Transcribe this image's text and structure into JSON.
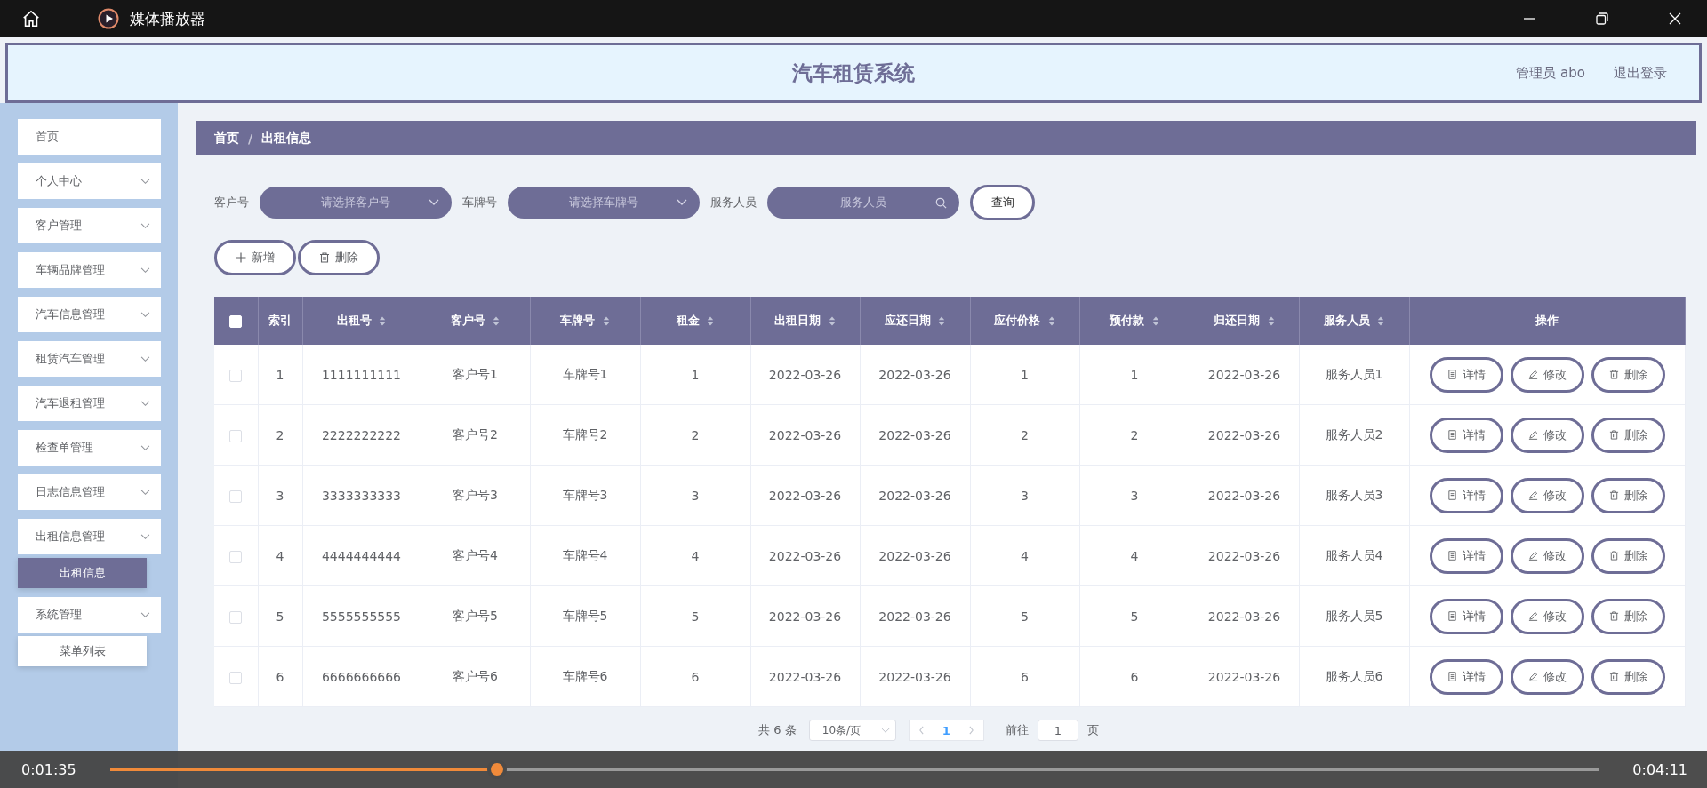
{
  "window": {
    "title": "媒体播放器"
  },
  "header": {
    "title": "汽车租赁系统",
    "user": "管理员 abo",
    "logout": "退出登录"
  },
  "sidebar": {
    "items": [
      {
        "kind": "link",
        "label": "首页"
      },
      {
        "kind": "menu",
        "label": "个人中心"
      },
      {
        "kind": "menu",
        "label": "客户管理"
      },
      {
        "kind": "menu",
        "label": "车辆品牌管理"
      },
      {
        "kind": "menu",
        "label": "汽车信息管理"
      },
      {
        "kind": "menu",
        "label": "租赁汽车管理"
      },
      {
        "kind": "menu",
        "label": "汽车退租管理"
      },
      {
        "kind": "menu",
        "label": "检查单管理"
      },
      {
        "kind": "menu",
        "label": "日志信息管理"
      },
      {
        "kind": "menu",
        "label": "出租信息管理",
        "children": [
          {
            "label": "出租信息",
            "selected": true
          }
        ]
      },
      {
        "kind": "menu",
        "label": "系统管理",
        "children": [
          {
            "label": "菜单列表",
            "selected": false
          }
        ]
      }
    ]
  },
  "breadcrumb": {
    "items": [
      "首页",
      "出租信息"
    ],
    "separator": "/"
  },
  "filters": [
    {
      "kind": "select",
      "label": "客户号",
      "placeholder": "请选择客户号"
    },
    {
      "kind": "select",
      "label": "车牌号",
      "placeholder": "请选择车牌号"
    },
    {
      "kind": "search",
      "label": "服务人员",
      "placeholder": "服务人员"
    }
  ],
  "query_button": "查询",
  "toolbar": [
    {
      "kind": "add",
      "label": "新增"
    },
    {
      "kind": "delete",
      "label": "删除"
    }
  ],
  "table": {
    "select_all": {
      "checked": false
    },
    "columns": [
      {
        "label": "索引",
        "sortable": false
      },
      {
        "label": "出租号",
        "sortable": true
      },
      {
        "label": "客户号",
        "sortable": true
      },
      {
        "label": "车牌号",
        "sortable": true
      },
      {
        "label": "租金",
        "sortable": true
      },
      {
        "label": "出租日期",
        "sortable": true
      },
      {
        "label": "应还日期",
        "sortable": true
      },
      {
        "label": "应付价格",
        "sortable": true
      },
      {
        "label": "预付款",
        "sortable": true
      },
      {
        "label": "归还日期",
        "sortable": true
      },
      {
        "label": "服务人员",
        "sortable": true
      },
      {
        "label": "操作",
        "sortable": false
      }
    ],
    "rows": [
      {
        "checked": false,
        "cells": [
          "1",
          "1111111111",
          "客户号1",
          "车牌号1",
          "1",
          "2022-03-26",
          "2022-03-26",
          "1",
          "1",
          "2022-03-26",
          "服务人员1"
        ],
        "actions": [
          {
            "kind": "detail",
            "label": "详情"
          },
          {
            "kind": "edit",
            "label": "修改"
          },
          {
            "kind": "delete",
            "label": "删除"
          }
        ]
      },
      {
        "checked": false,
        "cells": [
          "2",
          "2222222222",
          "客户号2",
          "车牌号2",
          "2",
          "2022-03-26",
          "2022-03-26",
          "2",
          "2",
          "2022-03-26",
          "服务人员2"
        ],
        "actions": [
          {
            "kind": "detail",
            "label": "详情"
          },
          {
            "kind": "edit",
            "label": "修改"
          },
          {
            "kind": "delete",
            "label": "删除"
          }
        ]
      },
      {
        "checked": false,
        "cells": [
          "3",
          "3333333333",
          "客户号3",
          "车牌号3",
          "3",
          "2022-03-26",
          "2022-03-26",
          "3",
          "3",
          "2022-03-26",
          "服务人员3"
        ],
        "actions": [
          {
            "kind": "detail",
            "label": "详情"
          },
          {
            "kind": "edit",
            "label": "修改"
          },
          {
            "kind": "delete",
            "label": "删除"
          }
        ]
      },
      {
        "checked": false,
        "cells": [
          "4",
          "4444444444",
          "客户号4",
          "车牌号4",
          "4",
          "2022-03-26",
          "2022-03-26",
          "4",
          "4",
          "2022-03-26",
          "服务人员4"
        ],
        "actions": [
          {
            "kind": "detail",
            "label": "详情"
          },
          {
            "kind": "edit",
            "label": "修改"
          },
          {
            "kind": "delete",
            "label": "删除"
          }
        ]
      },
      {
        "checked": false,
        "cells": [
          "5",
          "5555555555",
          "客户号5",
          "车牌号5",
          "5",
          "2022-03-26",
          "2022-03-26",
          "5",
          "5",
          "2022-03-26",
          "服务人员5"
        ],
        "actions": [
          {
            "kind": "detail",
            "label": "详情"
          },
          {
            "kind": "edit",
            "label": "修改"
          },
          {
            "kind": "delete",
            "label": "删除"
          }
        ]
      },
      {
        "checked": false,
        "cells": [
          "6",
          "6666666666",
          "客户号6",
          "车牌号6",
          "6",
          "2022-03-26",
          "2022-03-26",
          "6",
          "6",
          "2022-03-26",
          "服务人员6"
        ],
        "actions": [
          {
            "kind": "detail",
            "label": "详情"
          },
          {
            "kind": "edit",
            "label": "修改"
          },
          {
            "kind": "delete",
            "label": "删除"
          }
        ]
      }
    ]
  },
  "pagination": {
    "total": "共 6 条",
    "page_size": "10条/页",
    "pages": [
      {
        "label": "1",
        "selected": true
      }
    ],
    "goto_label": "前往",
    "goto_value": "1",
    "goto_suffix": "页"
  },
  "player": {
    "elapsed": "0:01:35",
    "duration": "0:04:11",
    "level": 0.26
  }
}
